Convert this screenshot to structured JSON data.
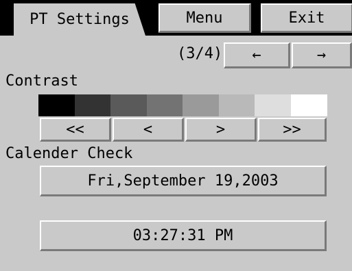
{
  "tabs": {
    "active": "PT Settings",
    "menu": "Menu",
    "exit": "Exit"
  },
  "pager": {
    "page_indicator": "(3/4)",
    "prev_label": "←",
    "next_label": "→"
  },
  "contrast": {
    "title": "Contrast",
    "swatches": [
      "#000000",
      "#333333",
      "#5a5a5a",
      "#737373",
      "#9a9a9a",
      "#b9b9b9",
      "#dedede",
      "#ffffff"
    ],
    "buttons": [
      "<<",
      "<",
      ">",
      ">>"
    ]
  },
  "calendar": {
    "title": "Calender Check",
    "date": "Fri,September 19,2003",
    "time": "03:27:31 PM"
  }
}
